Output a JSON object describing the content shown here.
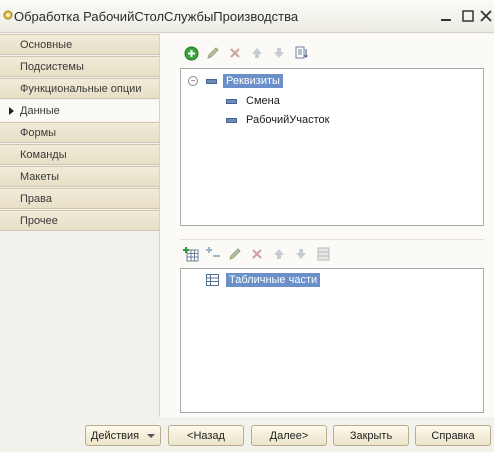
{
  "window": {
    "title": "Обработка РабочийСтолСлужбыПроизводства"
  },
  "tabs": [
    {
      "label": "Основные",
      "active": false
    },
    {
      "label": "Подсистемы",
      "active": false
    },
    {
      "label": "Функциональные опции",
      "active": false
    },
    {
      "label": "Данные",
      "active": true
    },
    {
      "label": "Формы",
      "active": false
    },
    {
      "label": "Команды",
      "active": false
    },
    {
      "label": "Макеты",
      "active": false
    },
    {
      "label": "Права",
      "active": false
    },
    {
      "label": "Прочее",
      "active": false
    }
  ],
  "attributes_tree": {
    "root": "Реквизиты",
    "children": [
      "Смена",
      "РабочийУчасток"
    ]
  },
  "tabular_tree": {
    "root": "Табличные части"
  },
  "buttons": {
    "actions": "Действия",
    "back": "<Назад",
    "next": "Далее>",
    "close": "Закрыть",
    "help": "Справка"
  },
  "colors": {
    "selection": "#6b90c9",
    "tab_bg": "#ece5cf",
    "accent_add": "#3aa53a"
  }
}
